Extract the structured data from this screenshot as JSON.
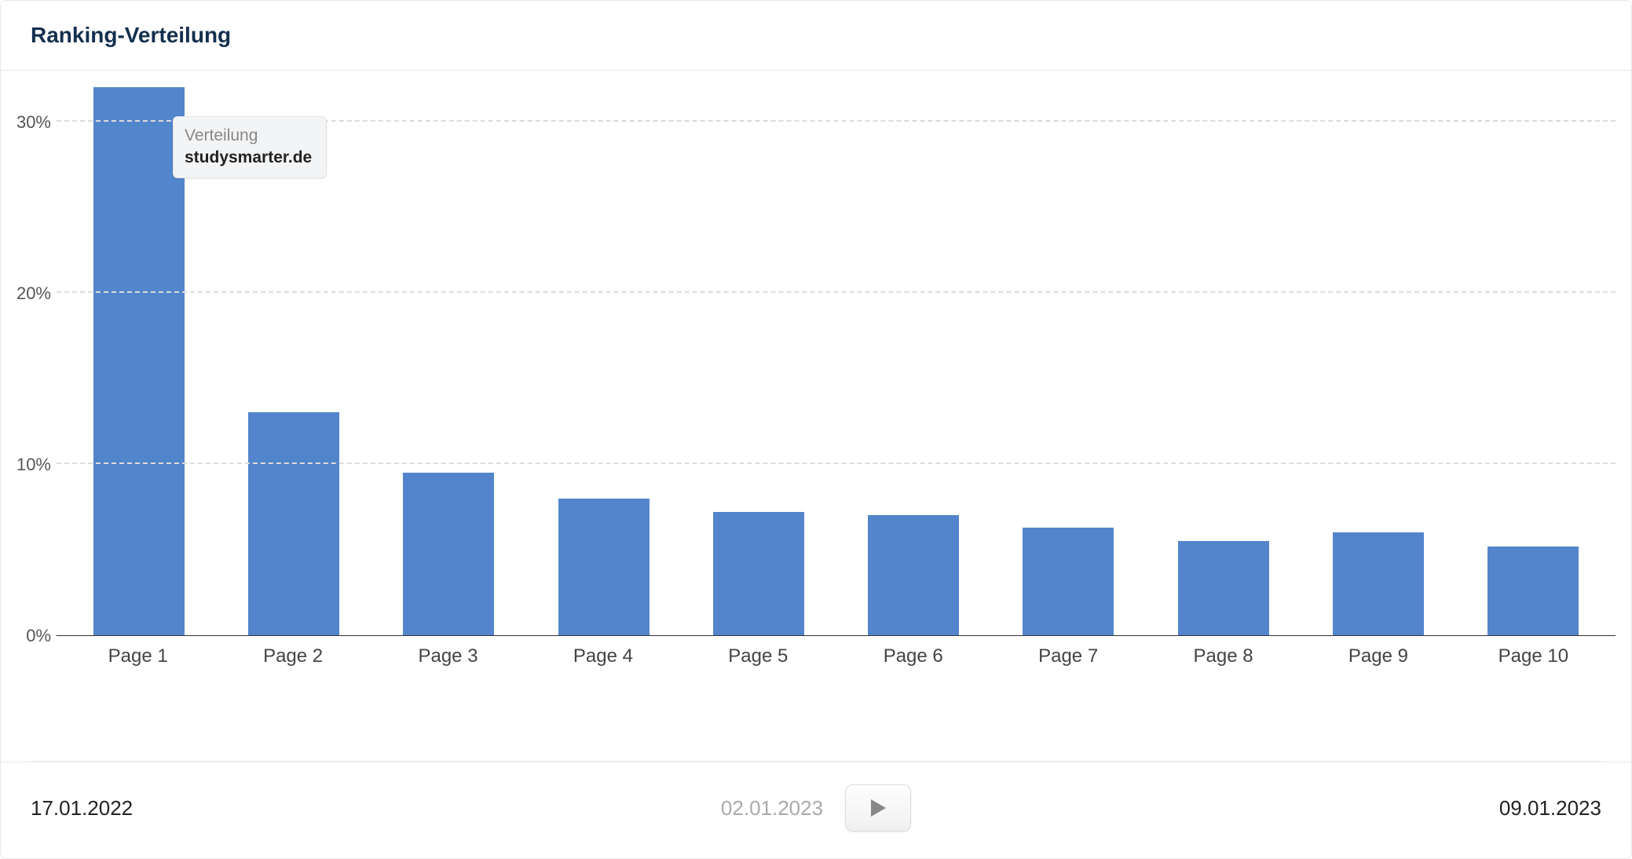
{
  "header": {
    "title": "Ranking-Verteilung"
  },
  "tooltip": {
    "label": "Verteilung",
    "value": "studysmarter.de"
  },
  "footer": {
    "start_date": "17.01.2022",
    "mid_date": "02.01.2023",
    "end_date": "09.01.2023"
  },
  "chart_data": {
    "type": "bar",
    "title": "Ranking-Verteilung",
    "xlabel": "",
    "ylabel": "",
    "ylim": [
      0,
      32
    ],
    "y_ticks": [
      0,
      10,
      20,
      30
    ],
    "y_tick_labels": [
      "0%",
      "10%",
      "20%",
      "30%"
    ],
    "categories": [
      "Page 1",
      "Page 2",
      "Page 3",
      "Page 4",
      "Page 5",
      "Page 6",
      "Page 7",
      "Page 8",
      "Page 9",
      "Page 10"
    ],
    "values": [
      32,
      13,
      9.5,
      8,
      7.2,
      7,
      6.3,
      5.5,
      6,
      5.2
    ],
    "series_label": "Verteilung",
    "series_source": "studysmarter.de",
    "bar_color": "#5385cc"
  }
}
